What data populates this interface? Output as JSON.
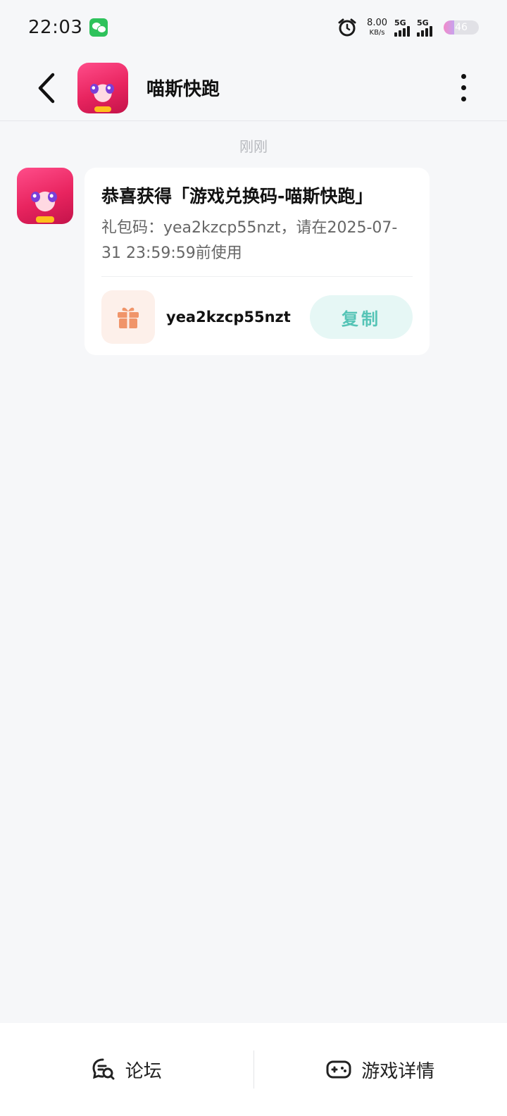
{
  "status_bar": {
    "time": "22:03",
    "net_speed": "8.00",
    "net_speed_unit": "KB/s",
    "signal_1": "5G",
    "signal_2": "5G",
    "battery": "46"
  },
  "header": {
    "title": "喵斯快跑"
  },
  "chat": {
    "timestamp": "刚刚",
    "message": {
      "title": "恭喜获得「游戏兑换码-喵斯快跑」",
      "body": "礼包码：yea2kzcp55nzt，请在2025-07-31 23:59:59前使用",
      "code": "yea2kzcp55nzt",
      "copy_label": "复制"
    }
  },
  "bottom_bar": {
    "forum_label": "论坛",
    "game_detail_label": "游戏详情"
  },
  "colors": {
    "background": "#f6f7f9",
    "accent": "#55c4b6",
    "copy_button_bg": "#e6f7f5",
    "gift_color": "#f0956a"
  }
}
